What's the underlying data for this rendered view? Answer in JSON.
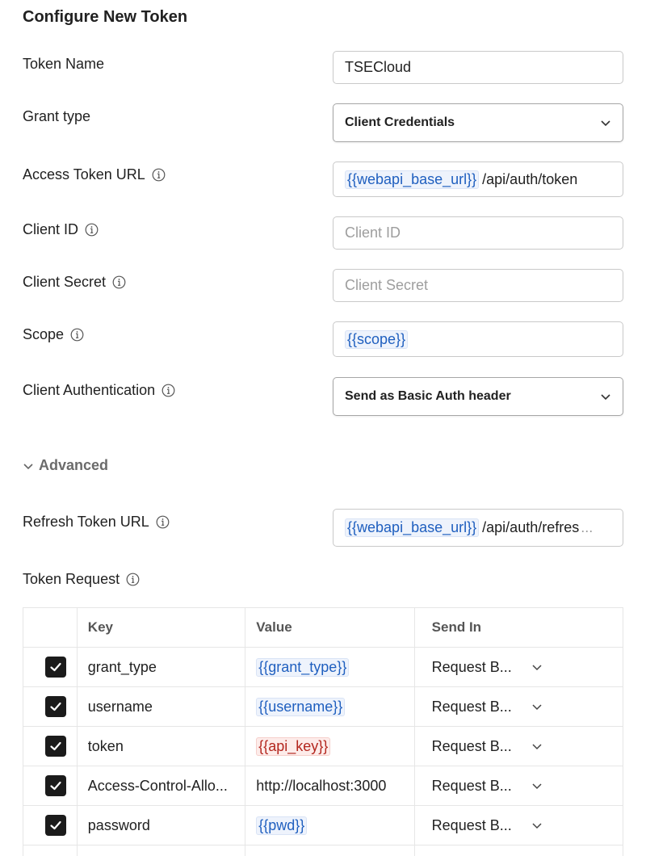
{
  "title": "Configure New Token",
  "fields": {
    "token_name": {
      "label": "Token Name",
      "value": "TSECloud"
    },
    "grant_type": {
      "label": "Grant type",
      "value": "Client Credentials"
    },
    "access_token_url": {
      "label": "Access Token URL",
      "var": "{{webapi_base_url}}",
      "rest": "/api/auth/token"
    },
    "client_id": {
      "label": "Client ID",
      "placeholder": "Client ID"
    },
    "client_secret": {
      "label": "Client Secret",
      "placeholder": "Client Secret"
    },
    "scope": {
      "label": "Scope",
      "var": "{{scope}}"
    },
    "client_authentication": {
      "label": "Client Authentication",
      "value": "Send as Basic Auth header"
    }
  },
  "advanced": {
    "label": "Advanced"
  },
  "refresh_token_url": {
    "label": "Refresh Token URL",
    "var": "{{webapi_base_url}}",
    "rest": "/api/auth/refres",
    "ellipsis": "..."
  },
  "token_request": {
    "label": "Token Request",
    "headers": {
      "key": "Key",
      "value": "Value",
      "send_in": "Send In"
    },
    "rows": [
      {
        "checked": true,
        "key": "grant_type",
        "value": "{{grant_type}}",
        "value_kind": "var",
        "send_in": "Request B..."
      },
      {
        "checked": true,
        "key": "username",
        "value": "{{username}}",
        "value_kind": "var",
        "send_in": "Request B..."
      },
      {
        "checked": true,
        "key": "token",
        "value": "{{api_key}}",
        "value_kind": "var-unresolved",
        "send_in": "Request B..."
      },
      {
        "checked": true,
        "key": "Access-Control-Allo...",
        "value": "http://localhost:3000",
        "value_kind": "text",
        "send_in": "Request B..."
      },
      {
        "checked": true,
        "key": "password",
        "value": "{{pwd}}",
        "value_kind": "var",
        "send_in": "Request B..."
      }
    ]
  },
  "icons": {
    "info": "info-icon",
    "chevron": "chevron-down-icon",
    "check": "checkmark-icon"
  },
  "colors": {
    "variable": "#1f5fbf",
    "variable_unresolved": "#b3261e",
    "checkbox": "#1b1b1b"
  }
}
